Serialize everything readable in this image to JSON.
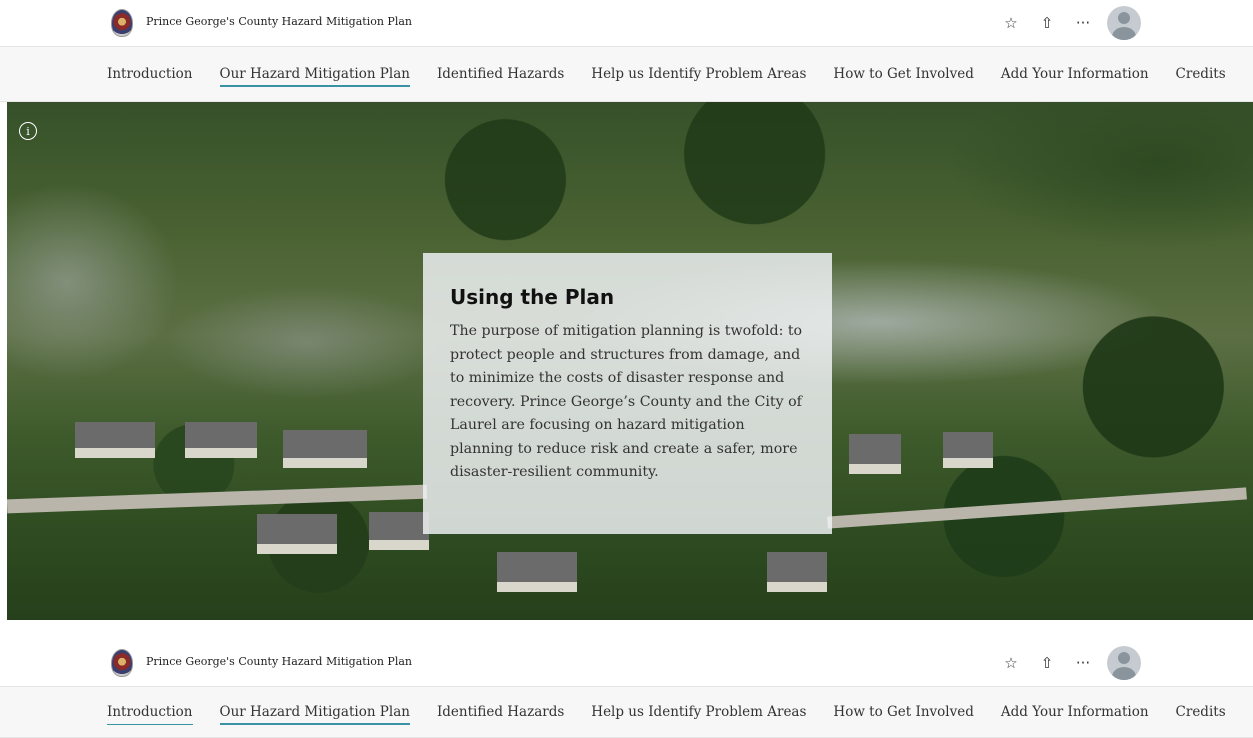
{
  "site": {
    "title": "Prince George's County Hazard Mitigation Plan"
  },
  "toolbar": {
    "star_icon": "☆",
    "share_icon": "⇧",
    "more_icon": "···"
  },
  "nav": {
    "items": [
      {
        "label": "Introduction"
      },
      {
        "label": "Our Hazard Mitigation Plan"
      },
      {
        "label": "Identified Hazards"
      },
      {
        "label": "Help us Identify Problem Areas"
      },
      {
        "label": "How to Get Involved"
      },
      {
        "label": "Add Your Information"
      },
      {
        "label": "Credits"
      }
    ]
  },
  "hero": {
    "info_glyph": "i",
    "card": {
      "heading": "Using the Plan",
      "body": "The purpose of mitigation planning is twofold: to protect people and structures from damage, and to minimize the costs of disaster response and recovery. Prince George’s County and the City of Laurel are focusing on hazard mitigation planning to reduce risk and create a safer, more disaster-resilient community."
    }
  },
  "colors": {
    "accent": "#3a93a5",
    "nav_background": "#f7f7f7"
  }
}
